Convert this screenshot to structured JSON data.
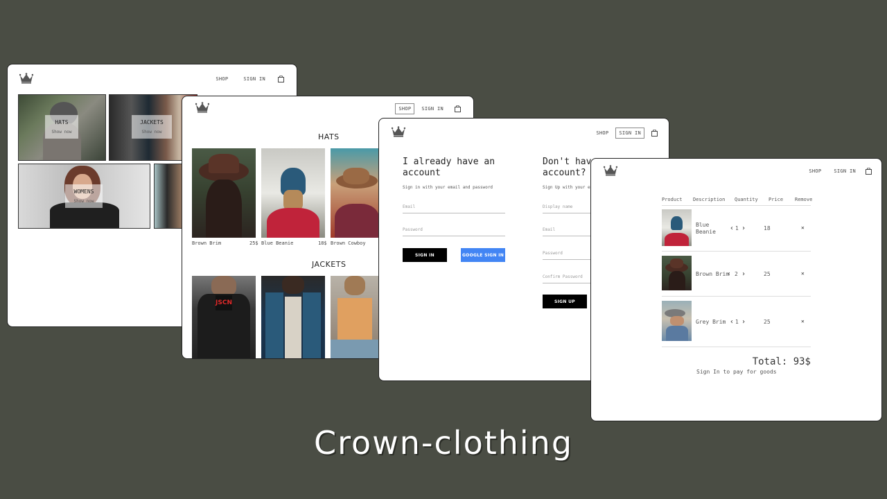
{
  "nav": {
    "shop": "SHOP",
    "sign_in": "SIGN IN"
  },
  "home": {
    "categories": [
      {
        "title": "HATS",
        "cta": "Show now"
      },
      {
        "title": "JACKETS",
        "cta": "Show now"
      },
      {
        "title": "WOMENS",
        "cta": "Show now"
      }
    ]
  },
  "shop": {
    "hats_title": "HATS",
    "jackets_title": "JACKETS",
    "hats": [
      {
        "name": "Brown Brim",
        "price": "25$"
      },
      {
        "name": "Blue Beanie",
        "price": "18$"
      },
      {
        "name": "Brown Cowboy",
        "price": ""
      }
    ]
  },
  "auth": {
    "signin_title": "I already have an account",
    "signin_sub": "Sign in with your email and password",
    "email_ph": "Email",
    "password_ph": "Password",
    "signin_btn": "SIGN IN",
    "google_btn": "GOOGLE SIGN IN",
    "signup_title": "Don't have account?",
    "signup_sub": "Sign Up with your e",
    "display_ph": "Display name",
    "confirm_ph": "Confirm Password",
    "signup_btn": "SIGN UP"
  },
  "checkout": {
    "headers": [
      "Product",
      "Description",
      "Quantity",
      "Price",
      "Remove"
    ],
    "items": [
      {
        "name": "Blue Beanie",
        "qty": "1",
        "price": "18"
      },
      {
        "name": "Brown Brim",
        "qty": "2",
        "price": "25"
      },
      {
        "name": "Grey Brim",
        "qty": "1",
        "price": "25"
      }
    ],
    "total": "Total: 93$",
    "note": "Sign In to pay for goods"
  },
  "footer_title": "Crown-clothing",
  "colors": {
    "background": "#4a4d44",
    "google_blue": "#4285f4",
    "black": "#000000"
  }
}
